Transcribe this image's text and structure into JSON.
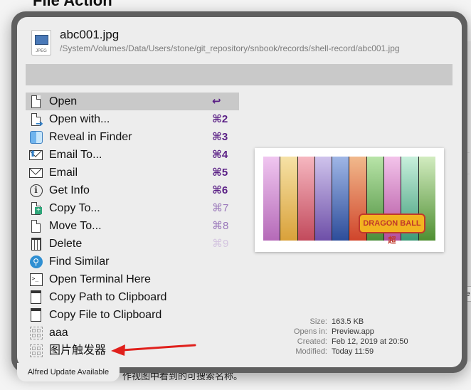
{
  "background": {
    "title": "File Action",
    "caption": "作视图中看到的可搜索名称。",
    "right_fragments": [
      "ty",
      "ty",
      "nce"
    ]
  },
  "alfred": {
    "file": {
      "name": "abc001.jpg",
      "path": "/System/Volumes/Data/Users/stone/git_repository/snbook/records/shell-record/abc001.jpg",
      "icon_label": "JPEG",
      "icon": "jpeg-file-icon"
    },
    "filter_text": "",
    "actions": [
      {
        "label": "Open",
        "shortcut": "↩",
        "icon": "document-icon",
        "selected": true
      },
      {
        "label": "Open with...",
        "shortcut": "⌘2",
        "icon": "open-with-icon"
      },
      {
        "label": "Reveal in Finder",
        "shortcut": "⌘3",
        "icon": "finder-icon"
      },
      {
        "label": "Email To...",
        "shortcut": "⌘4",
        "icon": "email-to-icon"
      },
      {
        "label": "Email",
        "shortcut": "⌘5",
        "icon": "envelope-icon"
      },
      {
        "label": "Get Info",
        "shortcut": "⌘6",
        "icon": "info-icon"
      },
      {
        "label": "Copy To...",
        "shortcut": "⌘7",
        "icon": "copy-to-icon"
      },
      {
        "label": "Move To...",
        "shortcut": "⌘8",
        "icon": "move-to-icon"
      },
      {
        "label": "Delete",
        "shortcut": "⌘9",
        "icon": "trash-icon"
      },
      {
        "label": "Find Similar",
        "shortcut": "",
        "icon": "search-icon"
      },
      {
        "label": "Open Terminal Here",
        "shortcut": "",
        "icon": "terminal-icon"
      },
      {
        "label": "Copy Path to Clipboard",
        "shortcut": "",
        "icon": "clipboard-icon"
      },
      {
        "label": "Copy File to Clipboard",
        "shortcut": "",
        "icon": "clipboard-icon"
      },
      {
        "label": "aaa",
        "shortcut": "",
        "icon": "workflow-placeholder-icon"
      },
      {
        "label": "图片触发器",
        "shortcut": "",
        "icon": "workflow-placeholder-icon"
      }
    ],
    "preview": {
      "logo_text": "DRAGON BALL 超"
    },
    "meta": [
      {
        "key": "Size:",
        "value": "163.5 KB"
      },
      {
        "key": "Opens in:",
        "value": "Preview.app"
      },
      {
        "key": "Created:",
        "value": "Feb 12, 2019 at 20:50"
      },
      {
        "key": "Modified:",
        "value": "Today 11:59"
      }
    ],
    "update_notice": "Alfred Update Available"
  },
  "colors": {
    "shortcut_accent": "#5a1f85",
    "selection": "#c9c9c9",
    "annotation_arrow": "#e0201c"
  }
}
